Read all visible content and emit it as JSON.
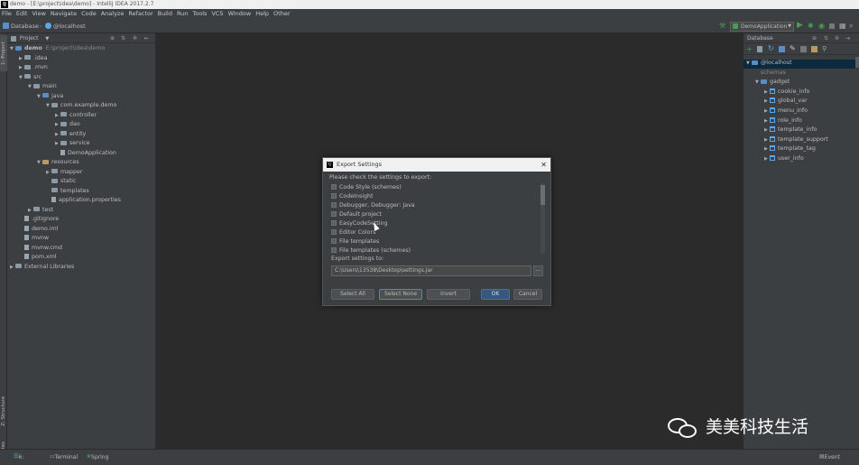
{
  "window": {
    "title": "demo - [E:\\project\\idea\\demo] - IntelliJ IDEA 2017.2.7",
    "app_icon": "IJ"
  },
  "menu": [
    "File",
    "Edit",
    "View",
    "Navigate",
    "Code",
    "Analyze",
    "Refactor",
    "Build",
    "Run",
    "Tools",
    "VCS",
    "Window",
    "Help",
    "Other"
  ],
  "navbar": {
    "crumb1": "Database",
    "crumb2": "@localhost",
    "run_config": "DemoApplication"
  },
  "left_tabs": {
    "project": "1: Project",
    "structure": "Z: Structure",
    "favorites": "2: Favorites"
  },
  "project_panel": {
    "header": "Project",
    "tree": [
      {
        "label": "demo",
        "extra": "E:\\project\\idea\\demo",
        "depth": 0,
        "arrow": "▼",
        "icon": "folder-blue"
      },
      {
        "label": ".idea",
        "depth": 1,
        "arrow": "▶",
        "icon": "folder"
      },
      {
        "label": ".mvn",
        "depth": 1,
        "arrow": "▶",
        "icon": "folder"
      },
      {
        "label": "src",
        "depth": 1,
        "arrow": "▼",
        "icon": "folder"
      },
      {
        "label": "main",
        "depth": 2,
        "arrow": "▼",
        "icon": "folder"
      },
      {
        "label": "java",
        "depth": 3,
        "arrow": "▼",
        "icon": "folder-blue"
      },
      {
        "label": "com.example.demo",
        "depth": 4,
        "arrow": "▼",
        "icon": "folder"
      },
      {
        "label": "controller",
        "depth": 5,
        "arrow": "▶",
        "icon": "folder"
      },
      {
        "label": "dao",
        "depth": 5,
        "arrow": "▶",
        "icon": "folder"
      },
      {
        "label": "entity",
        "depth": 5,
        "arrow": "▶",
        "icon": "folder"
      },
      {
        "label": "service",
        "depth": 5,
        "arrow": "▶",
        "icon": "folder"
      },
      {
        "label": "DemoApplication",
        "depth": 5,
        "arrow": "",
        "icon": "file"
      },
      {
        "label": "resources",
        "depth": 3,
        "arrow": "▼",
        "icon": "folder-orange"
      },
      {
        "label": "mapper",
        "depth": 4,
        "arrow": "▶",
        "icon": "folder"
      },
      {
        "label": "static",
        "depth": 4,
        "arrow": "",
        "icon": "folder"
      },
      {
        "label": "templates",
        "depth": 4,
        "arrow": "",
        "icon": "folder"
      },
      {
        "label": "application.properties",
        "depth": 4,
        "arrow": "",
        "icon": "file"
      },
      {
        "label": "test",
        "depth": 2,
        "arrow": "▶",
        "icon": "folder"
      },
      {
        "label": ".gitignore",
        "depth": 1,
        "arrow": "",
        "icon": "file"
      },
      {
        "label": "demo.iml",
        "depth": 1,
        "arrow": "",
        "icon": "file"
      },
      {
        "label": "mvnw",
        "depth": 1,
        "arrow": "",
        "icon": "file"
      },
      {
        "label": "mvnw.cmd",
        "depth": 1,
        "arrow": "",
        "icon": "file"
      },
      {
        "label": "pom.xml",
        "depth": 1,
        "arrow": "",
        "icon": "file"
      },
      {
        "label": "External Libraries",
        "depth": 0,
        "arrow": "▶",
        "icon": "folder"
      }
    ]
  },
  "db_panel": {
    "header": "Database",
    "tree": [
      {
        "label": "@localhost",
        "depth": 0,
        "arrow": "▼",
        "icon": "db"
      },
      {
        "label": "schemas",
        "depth": 1,
        "arrow": "",
        "icon": "none"
      },
      {
        "label": "gadget",
        "depth": 1,
        "arrow": "▼",
        "icon": "db"
      },
      {
        "label": "cookie_info",
        "depth": 2,
        "arrow": "▶",
        "icon": "table"
      },
      {
        "label": "global_var",
        "depth": 2,
        "arrow": "▶",
        "icon": "table"
      },
      {
        "label": "menu_info",
        "depth": 2,
        "arrow": "▶",
        "icon": "table"
      },
      {
        "label": "role_info",
        "depth": 2,
        "arrow": "▶",
        "icon": "table"
      },
      {
        "label": "template_info",
        "depth": 2,
        "arrow": "▶",
        "icon": "table"
      },
      {
        "label": "template_support",
        "depth": 2,
        "arrow": "▶",
        "icon": "table"
      },
      {
        "label": "template_tag",
        "depth": 2,
        "arrow": "▶",
        "icon": "table"
      },
      {
        "label": "user_info",
        "depth": 2,
        "arrow": "▶",
        "icon": "table"
      }
    ]
  },
  "dialog": {
    "title": "Export Settings",
    "instruction": "Please check the settings to export:",
    "items": [
      "Code Style (schemes)",
      "CodeInsight",
      "Debugger, Debugger: Java",
      "Default project",
      "EasyCodeSetting",
      "Editor Colors",
      "File templates",
      "File templates (schemes)"
    ],
    "export_label": "Export settings to:",
    "path": "C:\\Users\\13538\\Desktop\\settings.jar",
    "browse": "...",
    "buttons": {
      "select_all": "Select All",
      "select_none": "Select None",
      "invert": "Invert",
      "ok": "OK",
      "cancel": "Cancel"
    }
  },
  "bottom": {
    "todo": "6: TODO",
    "terminal": "Terminal",
    "spring": "Spring",
    "event_log": "Event Log"
  },
  "watermark": "美美科技生活",
  "colors": {
    "run_green": "#499c54",
    "accent_blue": "#4a88c7",
    "folder_blue": "#5a8cc6"
  }
}
